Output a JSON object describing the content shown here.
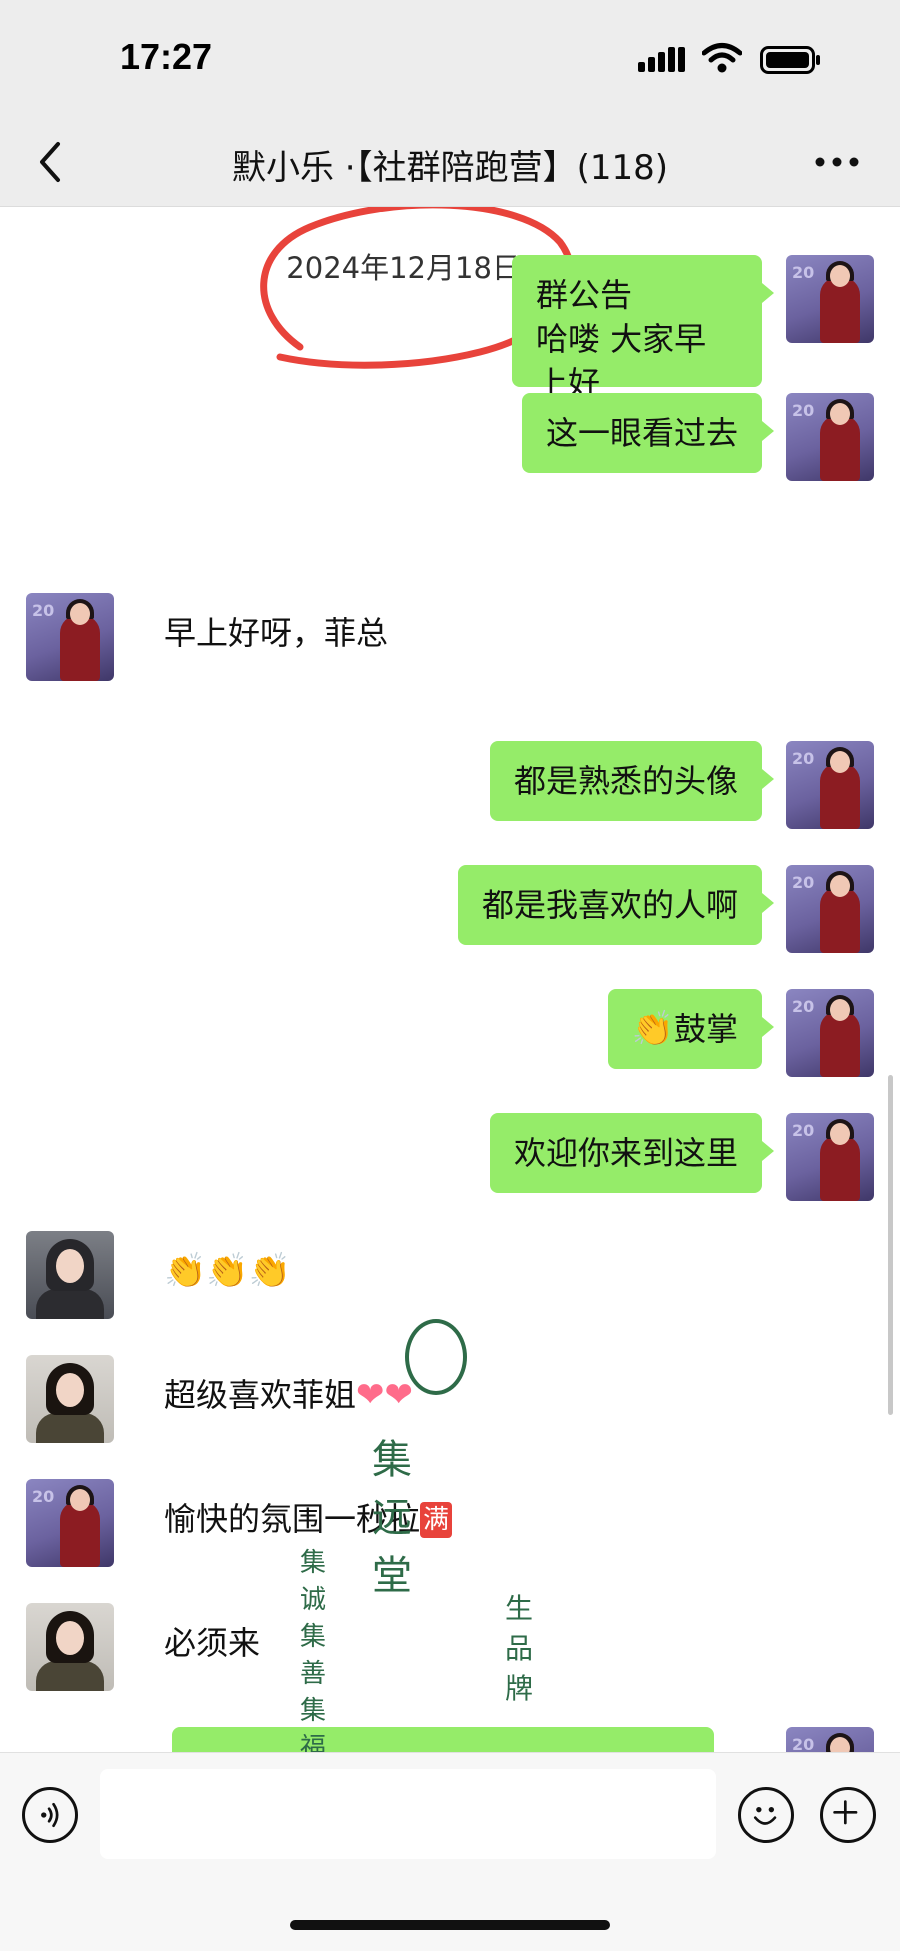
{
  "status_bar": {
    "time": "17:27"
  },
  "header": {
    "title": "默小乐 ·【社群陪跑营】(118)",
    "back_icon": "chevron-left-icon",
    "more_icon": "more-horizontal-icon"
  },
  "chat": {
    "timestamp": "2024年12月18日 09:00",
    "messages": [
      {
        "side": "out",
        "text": "群公告\n哈喽 大家早上好"
      },
      {
        "side": "out",
        "text": "这一眼看过去"
      },
      {
        "side": "in",
        "text": "早上好呀，菲总"
      },
      {
        "side": "out",
        "text": "都是熟悉的头像"
      },
      {
        "side": "out",
        "text": "都是我喜欢的人啊"
      },
      {
        "side": "out",
        "text": "鼓掌",
        "emoji": "👏"
      },
      {
        "side": "out",
        "text": "欢迎你来到这里"
      },
      {
        "side": "in",
        "text": "",
        "emoji": "👏👏👏"
      },
      {
        "side": "in",
        "text": "超级喜欢菲姐",
        "emoji": "❤❤"
      },
      {
        "side": "in",
        "text": "愉快的氛围一秒拉",
        "emoji": "满"
      },
      {
        "side": "in",
        "text": "必须来"
      }
    ]
  },
  "watermark": {
    "name": "集远堂",
    "slogan": "集诚  集善  集福",
    "brand": "生品牌"
  },
  "colors": {
    "bubble_out": "#95ec69",
    "bubble_in": "#ffffff",
    "annotation": "#e8433b",
    "watermark": "#2e6b48"
  },
  "input_bar": {
    "value": "",
    "voice_icon": "voice-icon",
    "emoji_icon": "emoji-face-icon",
    "plus_icon": "plus-circle-icon"
  }
}
